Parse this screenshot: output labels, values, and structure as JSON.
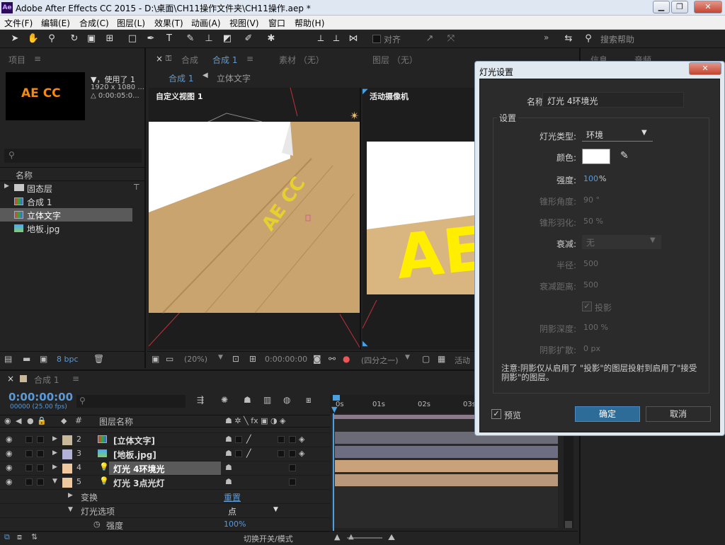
{
  "window": {
    "app_icon": "Ae",
    "title": "Adobe After Effects CC 2015 - D:\\桌面\\CH11操作文件夹\\CH11操作.aep *",
    "min": "▁",
    "max": "❐",
    "close": "✕"
  },
  "menu": [
    "文件(F)",
    "编辑(E)",
    "合成(C)",
    "图层(L)",
    "效果(T)",
    "动画(A)",
    "视图(V)",
    "窗口",
    "帮助(H)"
  ],
  "toolbar": {
    "snap_label": "对齐",
    "more": "»",
    "search_placeholder": "搜索帮助"
  },
  "project": {
    "tab": "项目",
    "menu": "≡",
    "thumb_text": "AE CC",
    "used": "▼，使用了 1",
    "dims": "1920 x 1080 ...",
    "dur": "△ 0:00:05:0...",
    "search_icon": "⚲",
    "col_name": "名称",
    "items": [
      {
        "name": "固态层",
        "type": "folder"
      },
      {
        "name": "合成 1",
        "type": "comp"
      },
      {
        "name": "立体文字",
        "type": "comp"
      },
      {
        "name": "地板.jpg",
        "type": "image"
      }
    ],
    "bpc": "8 bpc"
  },
  "viewer": {
    "close": "×",
    "lock": "🔓",
    "comp_label": "合成",
    "comp_name": "合成 1",
    "tab_menu": "≡",
    "footage_tab": "素材 （无）",
    "layer_tab": "图层 （无）",
    "breadcrumb": [
      "合成 1",
      "立体文字"
    ],
    "view_left": "自定义视图 1",
    "view_right": "活动摄像机",
    "scene_text": "AE CC",
    "scene_text_right": "AE",
    "zoom": "(20%)",
    "time": "0:00:00:00",
    "views": "(四分之一)",
    "active": "活动"
  },
  "dialog": {
    "title": "灯光设置",
    "close": "✕",
    "name_label": "名称:",
    "name_value": "灯光 4环境光",
    "group": "设置",
    "type_label": "灯光类型:",
    "type_value": "环境",
    "color_label": "颜色:",
    "intensity_label": "强度:",
    "intensity_value": "100",
    "intensity_unit": "%",
    "cone_angle_label": "锥形角度:",
    "cone_angle_value": "90 °",
    "cone_feather_label": "锥形羽化:",
    "cone_feather_value": "50 %",
    "falloff_label": "衰减:",
    "falloff_value": "无",
    "radius_label": "半径:",
    "radius_value": "500",
    "falloff_dist_label": "衰减距离:",
    "falloff_dist_value": "500",
    "shadow_label": "投影",
    "shadow_depth_label": "阴影深度:",
    "shadow_depth_value": "100 %",
    "shadow_diff_label": "阴影扩散:",
    "shadow_diff_value": "0 px",
    "note": "注意:阴影仅从启用了 \"投影\"的图层投射到启用了\"接受阴影\"的图层。",
    "preview_label": "预览",
    "ok": "确定",
    "cancel": "取消",
    "color_hex": "#ffffff"
  },
  "right_panel": {
    "tabs": [
      "信息",
      "音频"
    ]
  },
  "timeline": {
    "close": "×",
    "tab": "合成 1",
    "tab_menu": "≡",
    "timecode": "0:00:00:00",
    "frames": "00000 (25.00 fps)",
    "col_num": "#",
    "col_name": "图层名称",
    "ruler": [
      "0s",
      "01s",
      "02s",
      "03s"
    ],
    "layers": [
      {
        "num": "2",
        "name": "[立体文字]",
        "color": "#c9b89a",
        "bar": "#6b6b78"
      },
      {
        "num": "3",
        "name": "[地板.jpg]",
        "color": "#b2b2d8",
        "bar": "#6e6e82"
      },
      {
        "num": "4",
        "name": "灯光 4环境光",
        "color": "#f0c8a0",
        "bar": "#c9a27a"
      },
      {
        "num": "5",
        "name": "灯光 3点光灯",
        "color": "#f0c8a0",
        "bar": "#b8977a"
      }
    ],
    "transform": "变换",
    "reset": "重置",
    "light_options": "灯光选项",
    "light_type": "点",
    "intensity": "强度",
    "intensity_value": "100%",
    "footer": "切换开关/模式"
  }
}
